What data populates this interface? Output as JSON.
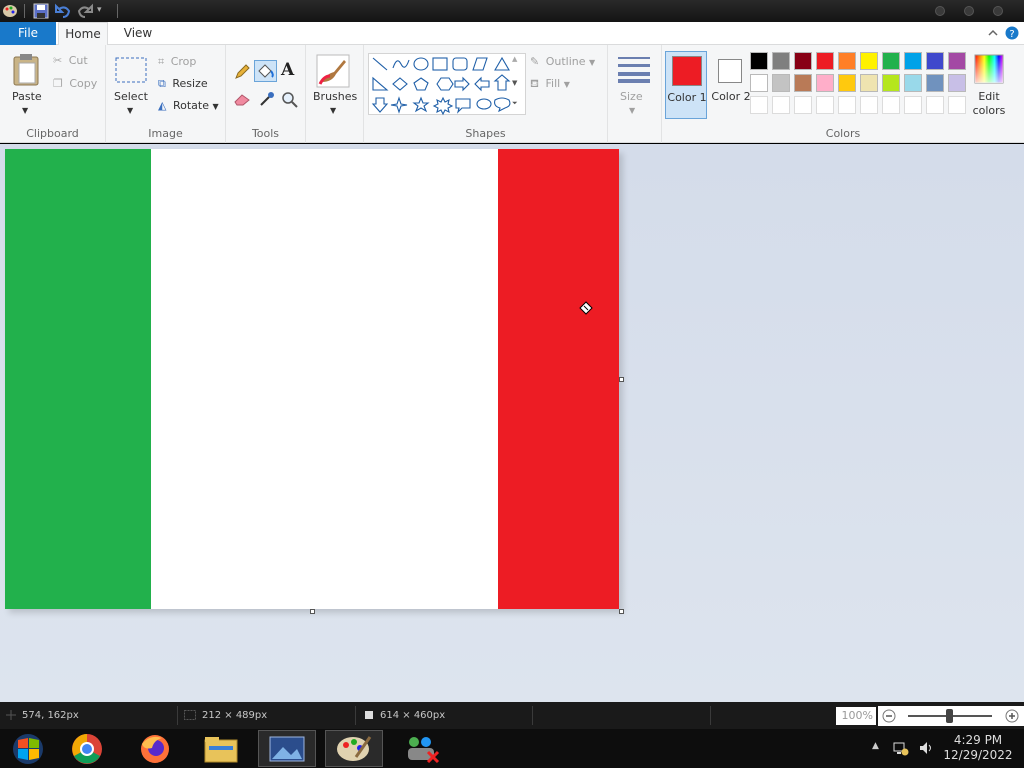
{
  "ribbon_tabs": {
    "file": "File",
    "home": "Home",
    "view": "View"
  },
  "clipboard": {
    "paste": "Paste",
    "cut": "Cut",
    "copy": "Copy",
    "label": "Clipboard"
  },
  "image": {
    "select": "Select",
    "crop": "Crop",
    "resize": "Resize",
    "rotate": "Rotate",
    "label": "Image"
  },
  "tools": {
    "label": "Tools",
    "text_tool_glyph": "A"
  },
  "brushes": {
    "label": "Brushes"
  },
  "shapes": {
    "outline": "Outline",
    "fill": "Fill",
    "label": "Shapes"
  },
  "size": {
    "label": "Size"
  },
  "colors": {
    "color1_label": "Color 1",
    "color2_label": "Color 2",
    "edit_colors": "Edit colors",
    "label": "Colors",
    "color1_value": "#ed1c24",
    "color2_value": "#ffffff",
    "palette_row1": [
      "#000000",
      "#7f7f7f",
      "#880015",
      "#ed1c24",
      "#ff7f27",
      "#fff200",
      "#22b14c",
      "#00a2e8",
      "#3f48cc",
      "#a349a4"
    ],
    "palette_row2": [
      "#ffffff",
      "#c3c3c3",
      "#b97a57",
      "#ffaec9",
      "#ffc90e",
      "#efe4b0",
      "#b5e61d",
      "#99d9ea",
      "#7092be",
      "#c8bfe7"
    ]
  },
  "canvas": {
    "flag_colors": [
      "#22b14c",
      "#ffffff",
      "#ed1c24"
    ]
  },
  "status": {
    "cursor_pos": "574, 162px",
    "selection_size": "212 × 489px",
    "image_size": "614 × 460px",
    "zoom": "100%"
  },
  "taskbar": {
    "time": "4:29 PM",
    "date": "12/29/2022"
  }
}
